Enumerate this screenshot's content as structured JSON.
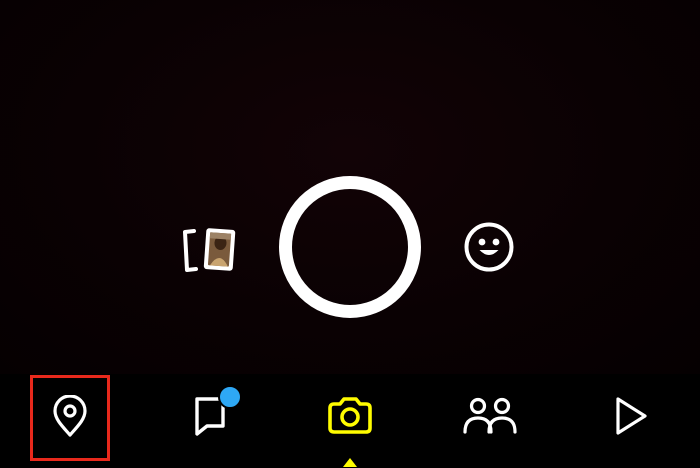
{
  "colors": {
    "background": "#000000",
    "icon": "#ffffff",
    "active_tab": "#fffc00",
    "notification_badge": "#2ea8f5",
    "highlight": "#e8291c"
  },
  "camera": {
    "shutter_icon": "shutter-ring",
    "memories_icon": "memories-cards-icon",
    "lens_icon": "smiley-face-icon"
  },
  "nav": {
    "active_tab": "camera",
    "highlighted_tab": "map",
    "items": [
      {
        "id": "map",
        "icon": "map-pin-icon"
      },
      {
        "id": "chat",
        "icon": "chat-bubble-icon",
        "has_notification": true
      },
      {
        "id": "camera",
        "icon": "camera-icon"
      },
      {
        "id": "stories",
        "icon": "friends-icon"
      },
      {
        "id": "spotlight",
        "icon": "play-icon"
      }
    ]
  }
}
